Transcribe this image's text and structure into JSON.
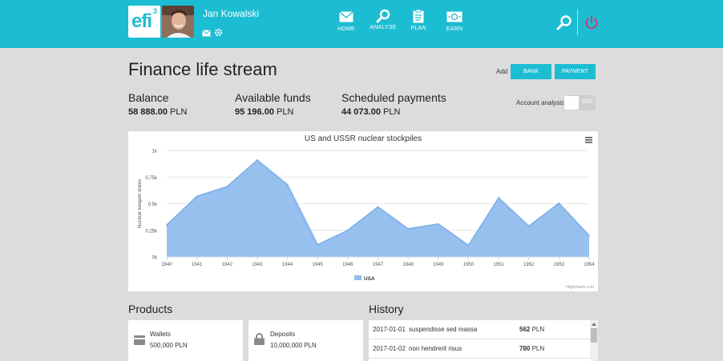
{
  "header": {
    "logo_text": "efi",
    "logo_sup": "3",
    "username": "Jan Kowalski",
    "user_icons": [
      "envelope-icon",
      "gear-icon"
    ],
    "nav": [
      {
        "label": "HOME",
        "icon": "envelope-icon"
      },
      {
        "label": "ANALYSE",
        "icon": "search-icon"
      },
      {
        "label": "PLAN",
        "icon": "clipboard-icon"
      },
      {
        "label": "EARN",
        "icon": "money-icon"
      }
    ],
    "right_icons": [
      "search-icon",
      "power-icon"
    ],
    "colors": {
      "bar": "#1cbdd2",
      "power": "#d6336c"
    }
  },
  "page": {
    "title": "Finance life stream",
    "add_label": "Add",
    "buttons": {
      "bank": "BANK",
      "payment": "PAYMENT"
    },
    "account_analysis": {
      "label": "Account analysis",
      "toggle_text": "OFF",
      "enabled": false
    }
  },
  "stats": [
    {
      "label": "Balance",
      "amount": "58 888.00",
      "currency": "PLN"
    },
    {
      "label": "Available funds",
      "amount": "95 196.00",
      "currency": "PLN"
    },
    {
      "label": "Scheduled payments",
      "amount": "44 073.00",
      "currency": "PLN"
    }
  ],
  "chart_data": {
    "type": "area",
    "title": "US and USSR nuclear stockpiles",
    "ylabel": "Nuclear weapon states",
    "xlabel": "",
    "x": [
      1940,
      1941,
      1942,
      1943,
      1944,
      1945,
      1946,
      1947,
      1948,
      1949,
      1950,
      1951,
      1952,
      1953,
      1954
    ],
    "y_ticks": [
      "0k",
      "0.25k",
      "0.5k",
      "0.75k",
      "1k"
    ],
    "ylim": [
      0,
      1000
    ],
    "series": [
      {
        "name": "USA",
        "values": [
          300,
          570,
          660,
          910,
          680,
          115,
          250,
          470,
          265,
          310,
          110,
          555,
          290,
          505,
          200
        ],
        "color": "#91bdee"
      }
    ],
    "legend": "bottom-center",
    "credits": "Highcharts.com",
    "menu_icon": "menu-icon",
    "grid": true
  },
  "products": {
    "title": "Products",
    "items": [
      {
        "name": "Wallets",
        "amount": "500,000 PLN",
        "icon": "wallet-icon"
      },
      {
        "name": "Deposits",
        "amount": "10,000,000 PLN",
        "icon": "lock-icon"
      }
    ]
  },
  "history": {
    "title": "History",
    "rows": [
      {
        "date": "2017-01-01",
        "text": "suspendisse sed massa",
        "amount": "562",
        "currency": "PLN"
      },
      {
        "date": "2017-01-02",
        "text": "non hendrerit risus",
        "amount": "780",
        "currency": "PLN"
      }
    ]
  }
}
